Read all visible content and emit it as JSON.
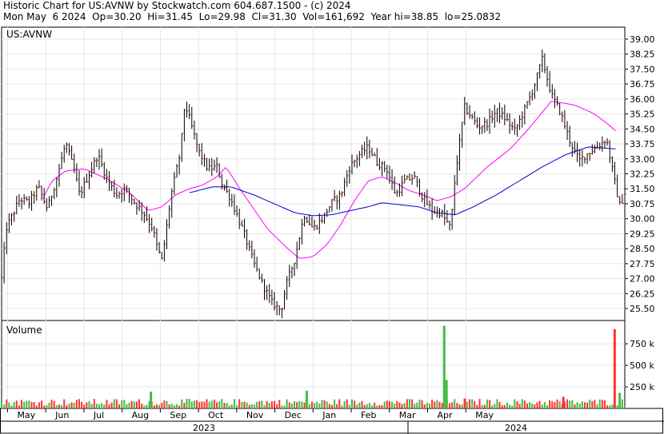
{
  "header": {
    "line1": "Historic Chart for US:AVNW by Stockwatch.com 604.687.1500 - (c) 2024",
    "line2": "Mon May  6 2024  Op=30.20  Hi=31.45  Lo=29.98  Cl=31.30  Vol=161,692  Year hi=38.85  lo=25.0832"
  },
  "chart_data": [
    {
      "type": "line",
      "title": "",
      "symbol_label": "US:AVNW",
      "ylim": [
        24.9,
        39.6
      ],
      "y_ticks": [
        "39.00",
        "38.25",
        "37.50",
        "36.75",
        "36.00",
        "35.25",
        "34.50",
        "33.75",
        "33.00",
        "32.25",
        "31.50",
        "30.75",
        "30.00",
        "29.25",
        "28.50",
        "27.75",
        "27.00",
        "26.25",
        "25.50"
      ],
      "x_month_labels": [
        "May",
        "Jun",
        "Jul",
        "Aug",
        "Sep",
        "Oct",
        "Nov",
        "Dec",
        "Jan",
        "Feb",
        "Mar",
        "Apr",
        "May"
      ],
      "x_year_labels": [
        "2023",
        "2024"
      ],
      "ohlc_style": "bar",
      "price_anchors": [
        [
          2023.32,
          27.0
        ],
        [
          2023.33,
          29.5
        ],
        [
          2023.36,
          31.0
        ],
        [
          2023.38,
          30.8
        ],
        [
          2023.4,
          31.6
        ],
        [
          2023.42,
          30.5
        ],
        [
          2023.44,
          32.0
        ],
        [
          2023.46,
          33.8
        ],
        [
          2023.48,
          32.3
        ],
        [
          2023.49,
          31.2
        ],
        [
          2023.51,
          32.2
        ],
        [
          2023.53,
          33.2
        ],
        [
          2023.55,
          32.0
        ],
        [
          2023.57,
          31.2
        ],
        [
          2023.59,
          31.5
        ],
        [
          2023.61,
          30.8
        ],
        [
          2023.63,
          30.3
        ],
        [
          2023.65,
          29.5
        ],
        [
          2023.66,
          28.5
        ],
        [
          2023.67,
          27.9
        ],
        [
          2023.69,
          31.2
        ],
        [
          2023.71,
          33.3
        ],
        [
          2023.72,
          35.8
        ],
        [
          2023.73,
          35.0
        ],
        [
          2023.75,
          33.4
        ],
        [
          2023.77,
          32.5
        ],
        [
          2023.79,
          32.6
        ],
        [
          2023.8,
          31.8
        ],
        [
          2023.82,
          31.0
        ],
        [
          2023.83,
          30.4
        ],
        [
          2023.85,
          29.2
        ],
        [
          2023.87,
          27.8
        ],
        [
          2023.89,
          26.7
        ],
        [
          2023.91,
          25.8
        ],
        [
          2023.93,
          25.4
        ],
        [
          2023.94,
          26.6
        ],
        [
          2023.96,
          28.0
        ],
        [
          2023.98,
          30.2
        ],
        [
          2024.0,
          29.5
        ],
        [
          2024.02,
          30.0
        ],
        [
          2024.04,
          30.8
        ],
        [
          2024.06,
          31.2
        ],
        [
          2024.08,
          32.6
        ],
        [
          2024.1,
          33.2
        ],
        [
          2024.12,
          33.6
        ],
        [
          2024.14,
          32.8
        ],
        [
          2024.16,
          32.5
        ],
        [
          2024.18,
          31.2
        ],
        [
          2024.2,
          31.9
        ],
        [
          2024.22,
          32.1
        ],
        [
          2024.24,
          31.0
        ],
        [
          2024.26,
          30.4
        ],
        [
          2024.28,
          30.3
        ],
        [
          2024.3,
          29.5
        ],
        [
          2024.31,
          32.2
        ],
        [
          2024.33,
          35.6
        ],
        [
          2024.36,
          34.6
        ],
        [
          2024.38,
          34.8
        ],
        [
          2024.4,
          35.4
        ],
        [
          2024.42,
          35.0
        ],
        [
          2024.44,
          34.4
        ],
        [
          2024.46,
          35.4
        ],
        [
          2024.48,
          36.5
        ],
        [
          2024.5,
          38.0
        ],
        [
          2024.52,
          36.2
        ],
        [
          2024.54,
          35.3
        ],
        [
          2024.56,
          33.9
        ],
        [
          2024.58,
          32.9
        ],
        [
          2024.6,
          33.3
        ],
        [
          2024.62,
          33.6
        ],
        [
          2024.64,
          34.0
        ],
        [
          2024.66,
          31.6
        ],
        [
          2024.67,
          30.6
        ],
        [
          2024.68,
          31.3
        ]
      ],
      "moving_averages": [
        {
          "color": "#ff00ff",
          "anchors": [
            [
              2023.41,
              31.0
            ],
            [
              2023.43,
              31.9
            ],
            [
              2023.46,
              32.4
            ],
            [
              2023.5,
              32.5
            ],
            [
              2023.55,
              32.0
            ],
            [
              2023.6,
              31.3
            ],
            [
              2023.64,
              30.4
            ],
            [
              2023.67,
              30.6
            ],
            [
              2023.7,
              31.2
            ],
            [
              2023.73,
              31.5
            ],
            [
              2023.76,
              31.7
            ],
            [
              2023.79,
              32.1
            ],
            [
              2023.81,
              32.6
            ],
            [
              2023.84,
              31.5
            ],
            [
              2023.87,
              30.5
            ],
            [
              2023.9,
              29.5
            ],
            [
              2023.94,
              28.6
            ],
            [
              2023.97,
              28.0
            ],
            [
              2024.0,
              28.1
            ],
            [
              2024.03,
              28.7
            ],
            [
              2024.06,
              29.7
            ],
            [
              2024.09,
              30.9
            ],
            [
              2024.12,
              31.9
            ],
            [
              2024.15,
              32.1
            ],
            [
              2024.18,
              31.8
            ],
            [
              2024.21,
              31.4
            ],
            [
              2024.24,
              31.2
            ],
            [
              2024.27,
              30.9
            ],
            [
              2024.3,
              31.1
            ],
            [
              2024.33,
              31.5
            ],
            [
              2024.38,
              32.6
            ],
            [
              2024.43,
              33.5
            ],
            [
              2024.47,
              34.5
            ],
            [
              2024.52,
              35.9
            ],
            [
              2024.57,
              35.7
            ],
            [
              2024.61,
              35.3
            ],
            [
              2024.64,
              34.8
            ],
            [
              2024.66,
              34.4
            ]
          ]
        },
        {
          "color": "#0000cc",
          "anchors": [
            [
              2023.73,
              31.3
            ],
            [
              2023.78,
              31.6
            ],
            [
              2023.82,
              31.6
            ],
            [
              2023.87,
              31.2
            ],
            [
              2023.92,
              30.7
            ],
            [
              2023.96,
              30.3
            ],
            [
              2024.0,
              30.15
            ],
            [
              2024.04,
              30.2
            ],
            [
              2024.08,
              30.4
            ],
            [
              2024.12,
              30.6
            ],
            [
              2024.15,
              30.8
            ],
            [
              2024.19,
              30.7
            ],
            [
              2024.23,
              30.6
            ],
            [
              2024.27,
              30.3
            ],
            [
              2024.31,
              30.2
            ],
            [
              2024.35,
              30.6
            ],
            [
              2024.4,
              31.2
            ],
            [
              2024.45,
              31.9
            ],
            [
              2024.5,
              32.6
            ],
            [
              2024.55,
              33.2
            ],
            [
              2024.6,
              33.6
            ],
            [
              2024.66,
              33.5
            ]
          ]
        }
      ]
    },
    {
      "type": "bar",
      "title": "Volume",
      "ylim": [
        0,
        1020
      ],
      "y_ticks": [
        "750 k",
        "500 k",
        "250 k"
      ],
      "y_tick_values": [
        750,
        500,
        250
      ],
      "unit": "k shares",
      "spikes": [
        {
          "x": 2024.285,
          "value": 960,
          "color": "#44bb44"
        },
        {
          "x": 2024.29,
          "value": 330,
          "color": "#44bb44"
        },
        {
          "x": 2024.657,
          "value": 920,
          "color": "#ff3333"
        },
        {
          "x": 2024.668,
          "value": 180,
          "color": "#44bb44"
        },
        {
          "x": 2023.645,
          "value": 195,
          "color": "#44bb44"
        },
        {
          "x": 2023.985,
          "value": 205,
          "color": "#44bb44"
        },
        {
          "x": 2024.33,
          "value": 115,
          "color": "#ff3333"
        },
        {
          "x": 2024.545,
          "value": 135,
          "color": "#ff3333"
        }
      ],
      "base_level": 90
    }
  ]
}
